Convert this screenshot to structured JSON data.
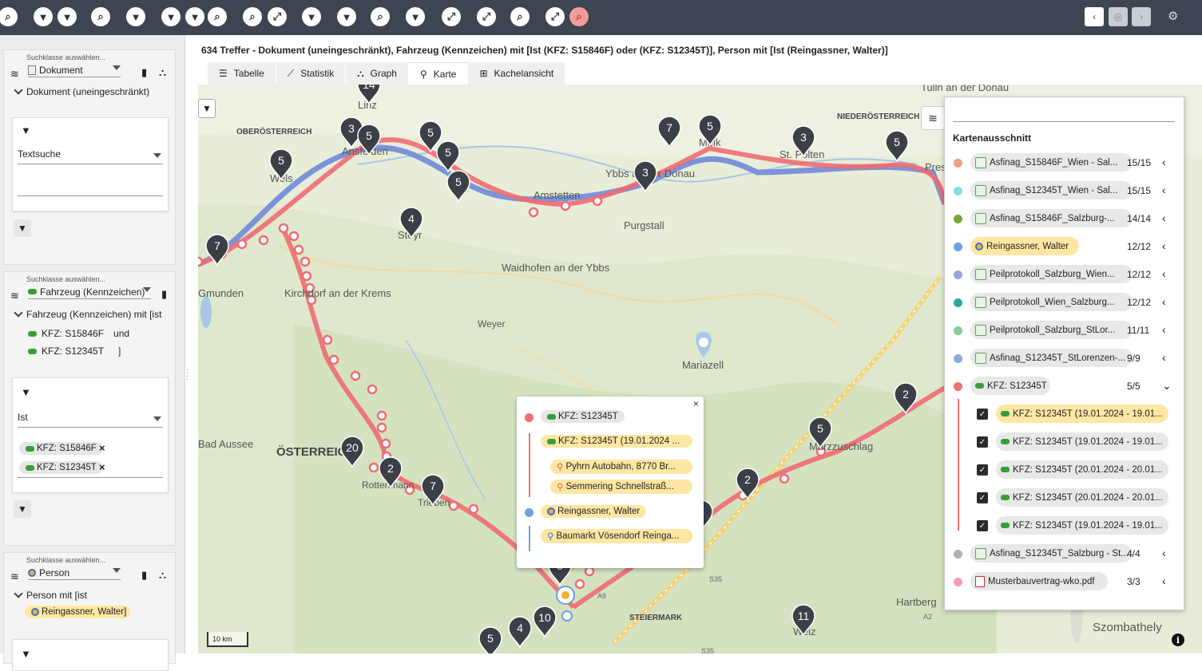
{
  "toolbar": {
    "buttons": [
      "search",
      "filter-add",
      "filter-remove",
      "search",
      "filter-star",
      "filter-star",
      "filter-star",
      "search",
      "search",
      "graph",
      "filter-star",
      "filter-star",
      "search",
      "filter-star",
      "graph",
      "graph",
      "search",
      "expand",
      "search-red"
    ],
    "nav_back": "‹",
    "nav_forward": "›"
  },
  "sidebar": {
    "panels": [
      {
        "hint": "Suchklasse auswählen...",
        "class": "Dokument",
        "tree_label": "Dokument (uneingeschränkt)",
        "filter_mode": "Textsuche",
        "filter_value": ""
      },
      {
        "hint": "Suchklasse auswählen...",
        "class": "Fahrzeug (Kennzeichen)",
        "tree_label": "Fahrzeug (Kennzeichen) mit [ist",
        "tree_items": [
          "KFZ: S15846F",
          "KFZ: S12345T"
        ],
        "connector": "und",
        "close_bracket": "]",
        "filter_mode": "Ist",
        "chips": [
          "KFZ: S15846F",
          "KFZ: S12345T"
        ]
      },
      {
        "hint": "Suchklasse auswählen...",
        "class": "Person",
        "tree_label": "Person mit [ist",
        "tree_items": [
          "Reingassner, Walter"
        ],
        "close_bracket": "]"
      }
    ]
  },
  "main": {
    "title": "634 Treffer - Dokument (uneingeschränkt), Fahrzeug (Kennzeichen) mit [Ist (KFZ: S15846F) oder (KFZ: S12345T)], Person mit [Ist (Reingassner, Walter)]",
    "tabs": [
      "Tabelle",
      "Statistik",
      "Graph",
      "Karte",
      "Kachelansicht"
    ],
    "active_tab": "Karte"
  },
  "map": {
    "scale": "10 km",
    "places": [
      {
        "name": "OBERÖSTERREICH"
      },
      {
        "name": "NIEDERÖSTERREICH"
      },
      {
        "name": "Linz"
      },
      {
        "name": "Ansfelden"
      },
      {
        "name": "Wels"
      },
      {
        "name": "Steyr"
      },
      {
        "name": "Amstetten"
      },
      {
        "name": "Ybbs an der Donau"
      },
      {
        "name": "Melk"
      },
      {
        "name": "St. Pölten"
      },
      {
        "name": "Purgstall"
      },
      {
        "name": "Waidhofen an der Ybbs"
      },
      {
        "name": "Kirchdorf an der Krems"
      },
      {
        "name": "Weyer"
      },
      {
        "name": "Mariazell"
      },
      {
        "name": "ÖSTERREICH"
      },
      {
        "name": "Bad Aussee"
      },
      {
        "name": "Rottenmann"
      },
      {
        "name": "Trieben"
      },
      {
        "name": "Mürzzuschlag"
      },
      {
        "name": "Gmunden"
      },
      {
        "name": "STEIERMARK"
      },
      {
        "name": "Hartberg"
      },
      {
        "name": "Szombathely"
      },
      {
        "name": "Weiz"
      },
      {
        "name": "Tulln an der Donau"
      },
      {
        "name": "Pressbaum"
      }
    ],
    "roads": [
      "A9",
      "S35",
      "S35",
      "A2"
    ],
    "clusters": [
      "14",
      "3",
      "5",
      "5",
      "5",
      "5",
      "5",
      "4",
      "3",
      "7",
      "5",
      "3",
      "5",
      "7",
      "2",
      "3",
      "20",
      "2",
      "7",
      "55",
      "5",
      "2",
      "2",
      "10",
      "4",
      "5",
      "11"
    ]
  },
  "popup": {
    "close": "×",
    "groups": [
      {
        "color": "#f07070",
        "label": "KFZ: S12345T",
        "items": [
          "KFZ: S12345T (19.01.2024 ...",
          "Pyhrn Autobahn, 8770 Br...",
          "Semmering Schnellstraß..."
        ]
      },
      {
        "color": "#6fa0e0",
        "label": "Reingassner, Walter",
        "items": [
          "Baumarkt Vösendorf Reinga..."
        ]
      }
    ]
  },
  "legend": {
    "title": "Kartenausschnitt",
    "rows": [
      {
        "color": "#f0a080",
        "label": "Asfinag_S15846F_Wien - Sal...",
        "count": "15/15",
        "icon": "doc"
      },
      {
        "color": "#7ee0e0",
        "label": "Asfinag_S12345T_Wien - Sal...",
        "count": "15/15",
        "icon": "doc"
      },
      {
        "color": "#77a838",
        "label": "Asfinag_S15846F_Salzburg-...",
        "count": "14/14",
        "icon": "doc"
      },
      {
        "color": "#6f9ee8",
        "label": "Reingassner, Walter",
        "count": "12/12",
        "icon": "person"
      },
      {
        "color": "#90a8e0",
        "label": "Peilprotokoll_Salzburg_Wien...",
        "count": "12/12",
        "icon": "doc"
      },
      {
        "color": "#2aa8a0",
        "label": "Peilprotokoll_Wien_Salzburg...",
        "count": "12/12",
        "icon": "doc"
      },
      {
        "color": "#88cc99",
        "label": "Peilprotokoll_Salzburg_StLor...",
        "count": "11/11",
        "icon": "doc"
      },
      {
        "color": "#90a8d8",
        "label": "Asfinag_S12345T_StLorenzen-...",
        "count": "9/9",
        "icon": "doc"
      },
      {
        "color": "#f07070",
        "label": "KFZ: S12345T",
        "count": "5/5",
        "icon": "car"
      }
    ],
    "subrows": [
      "KFZ: S12345T (19.01.2024 - 19.01...",
      "KFZ: S12345T (19.01.2024 - 19.01...",
      "KFZ: S12345T (20.01.2024 - 20.01...",
      "KFZ: S12345T (20.01.2024 - 20.01...",
      "KFZ: S12345T (19.01.2024 - 19.01..."
    ],
    "rows_after": [
      {
        "color": "#b0b0b0",
        "label": "Asfinag_S12345T_Salzburg - St...",
        "count": "4/4",
        "icon": "doc"
      },
      {
        "color": "#f0a0a8",
        "label": "Musterbauvertrag-wko.pdf",
        "count": "3/3",
        "icon": "pdf"
      }
    ]
  }
}
